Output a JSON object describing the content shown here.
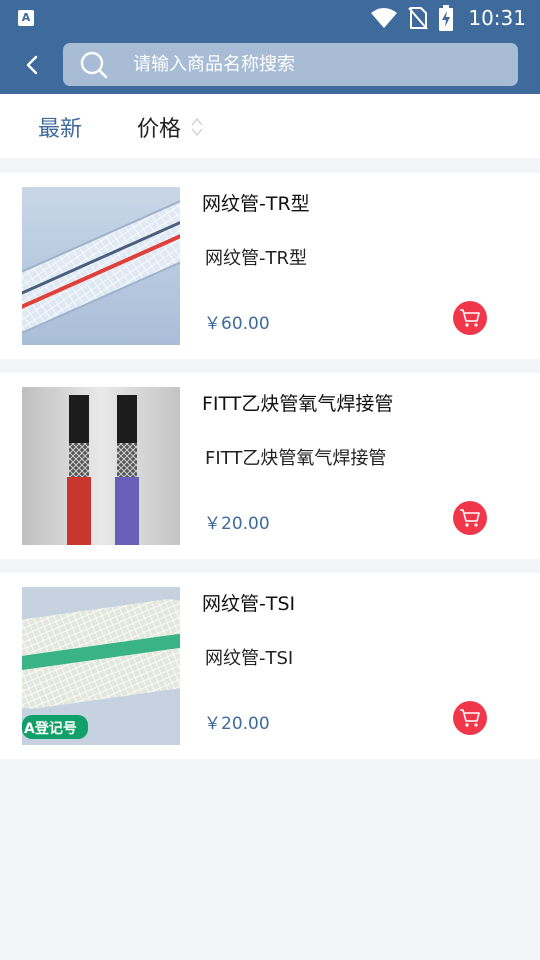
{
  "status_bar": {
    "app_icon_letter": "A",
    "time": "10:31",
    "icons": [
      "wifi-icon",
      "no-sim-icon",
      "battery-charging-icon"
    ]
  },
  "header": {
    "back_icon": "chevron-left-icon",
    "search": {
      "placeholder": "请输入商品名称搜索",
      "value": "",
      "icon": "search-icon"
    }
  },
  "sort_bar": {
    "latest_label": "最新",
    "price_label": "价格",
    "price_icon": "sort-arrows-icon"
  },
  "products": [
    {
      "name": "网纹管-TR型",
      "description": "网纹管-TR型",
      "price": "￥60.00",
      "image": "clear-braided-hose-red-stripe"
    },
    {
      "name": "FITT乙炔管氧气焊接管",
      "description": "FITT乙炔管氧气焊接管",
      "price": "￥20.00",
      "image": "red-and-blue-welding-hoses"
    },
    {
      "name": "网纹管-TSI",
      "description": "网纹管-TSI",
      "price": "￥20.00",
      "image": "clear-braided-hose-green-stripe",
      "image_badge": "A登记号"
    }
  ],
  "colors": {
    "primary": "#3f6a9c",
    "search_bg": "#a9bcd6",
    "cart": "#f2364a",
    "page_bg": "#f4f5f9"
  }
}
